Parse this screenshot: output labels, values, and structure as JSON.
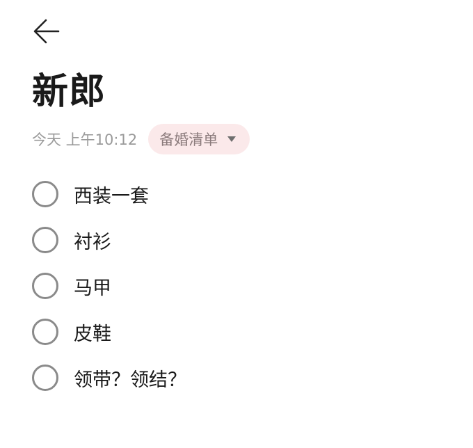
{
  "header": {
    "back_icon": "arrow-left-icon"
  },
  "note": {
    "title": "新郎",
    "timestamp": "今天 上午10:12",
    "category": "备婚清单",
    "category_bg": "#fbe9ea"
  },
  "todos": [
    {
      "text": "西装一套",
      "checked": false
    },
    {
      "text": "衬衫",
      "checked": false
    },
    {
      "text": "马甲",
      "checked": false
    },
    {
      "text": "皮鞋",
      "checked": false
    },
    {
      "text": "领带？领结？",
      "checked": false
    }
  ]
}
